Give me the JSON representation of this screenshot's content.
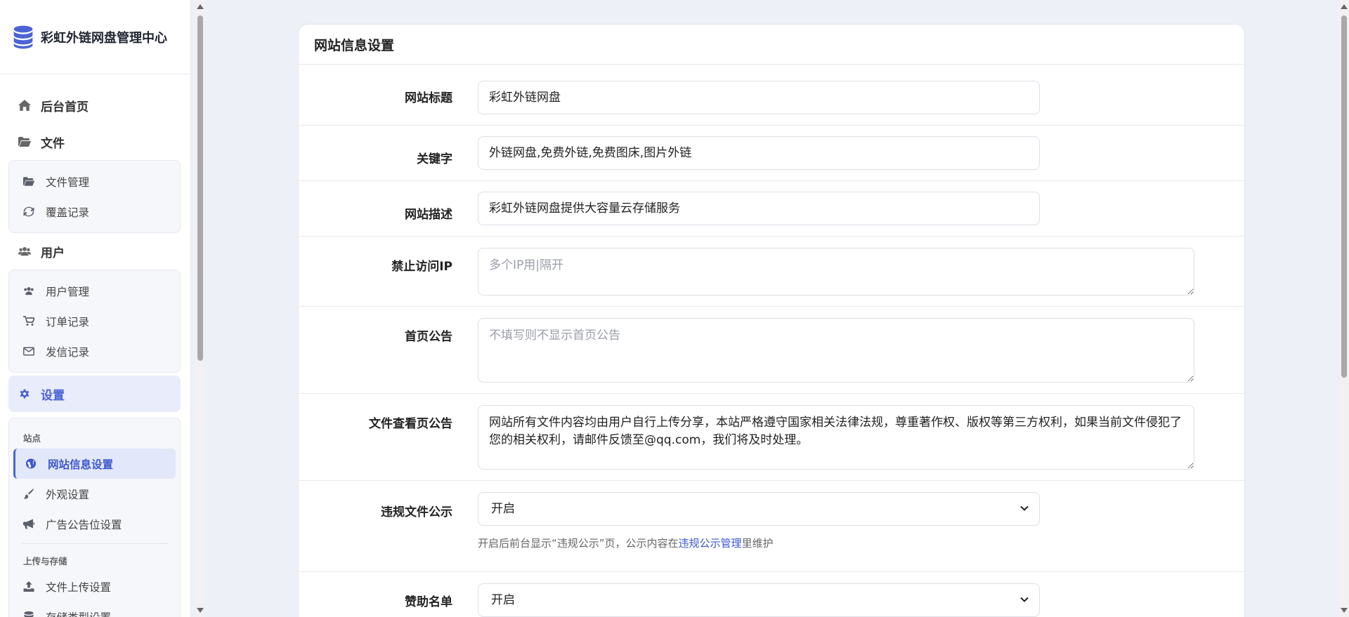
{
  "brand": {
    "title": "彩虹外链网盘管理中心",
    "icon": "database-icon"
  },
  "sidebar": {
    "home": {
      "label": "后台首页",
      "icon": "home-icon"
    },
    "file": {
      "label": "文件",
      "icon": "folder-open-icon",
      "items": [
        {
          "label": "文件管理",
          "icon": "folder-open-icon"
        },
        {
          "label": "覆盖记录",
          "icon": "refresh-icon"
        }
      ]
    },
    "user": {
      "label": "用户",
      "icon": "users-icon",
      "items": [
        {
          "label": "用户管理",
          "icon": "users-icon"
        },
        {
          "label": "订单记录",
          "icon": "cart-icon"
        },
        {
          "label": "发信记录",
          "icon": "envelope-icon"
        }
      ]
    },
    "settings": {
      "label": "设置",
      "icon": "gear-icon",
      "sections": [
        {
          "heading": "站点",
          "items": [
            {
              "label": "网站信息设置",
              "icon": "globe-icon",
              "active": true
            },
            {
              "label": "外观设置",
              "icon": "brush-icon"
            },
            {
              "label": "广告公告位设置",
              "icon": "bullhorn-icon"
            }
          ]
        },
        {
          "heading": "上传与存储",
          "items": [
            {
              "label": "文件上传设置",
              "icon": "upload-icon"
            },
            {
              "label": "存储类型设置",
              "icon": "database-icon"
            }
          ]
        }
      ]
    }
  },
  "main": {
    "title": "网站信息设置",
    "fields": {
      "title": {
        "label": "网站标题",
        "value": "彩虹外链网盘"
      },
      "keywords": {
        "label": "关键字",
        "value": "外链网盘,免费外链,免费图床,图片外链"
      },
      "description": {
        "label": "网站描述",
        "value": "彩虹外链网盘提供大容量云存储服务"
      },
      "blocked_ip": {
        "label": "禁止访问IP",
        "placeholder": "多个IP用|隔开",
        "value": ""
      },
      "home_notice": {
        "label": "首页公告",
        "placeholder": "不填写则不显示首页公告",
        "value": ""
      },
      "file_notice": {
        "label": "文件查看页公告",
        "value": "网站所有文件内容均由用户自行上传分享，本站严格遵守国家相关法律法规，尊重著作权、版权等第三方权利，如果当前文件侵犯了您的相关权利，请邮件反馈至@qq.com，我们将及时处理。"
      },
      "violation_public": {
        "label": "违规文件公示",
        "value": "开启",
        "help_prefix": "开启后前台显示“违规公示”页，公示内容在",
        "help_link": "违规公示管理",
        "help_suffix": "里维护"
      },
      "sponsor": {
        "label": "赞助名单",
        "value": "开启"
      }
    }
  },
  "colors": {
    "accent": "#4a63d6",
    "background": "#eef0f8"
  }
}
